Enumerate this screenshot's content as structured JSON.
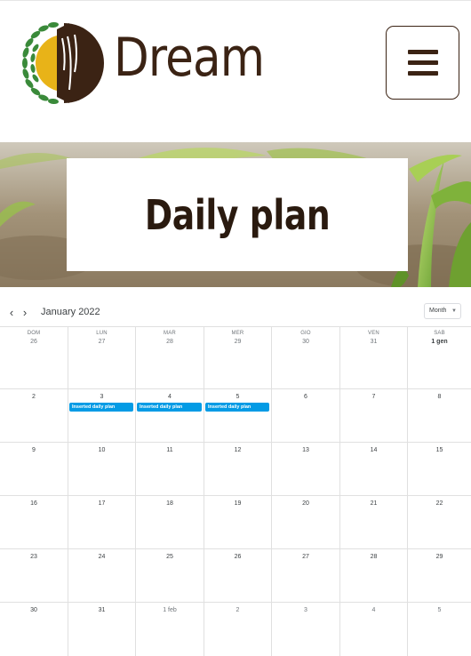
{
  "header": {
    "brand": "Dream",
    "menu_icon": "hamburger-menu-icon",
    "logo_colors": {
      "brown": "#3b2314",
      "yellow": "#e8b318",
      "green": "#3a8a3a"
    }
  },
  "hero": {
    "title": "Daily plan"
  },
  "calendar": {
    "month_label": "January 2022",
    "view_label": "Month",
    "prev_icon": "chevron-left-icon",
    "next_icon": "chevron-right-icon",
    "weekdays": [
      "DOM",
      "LUN",
      "MAR",
      "MER",
      "GIO",
      "VEN",
      "SAB"
    ],
    "weeks": [
      [
        {
          "d": "26",
          "other": true
        },
        {
          "d": "27",
          "other": true
        },
        {
          "d": "28",
          "other": true
        },
        {
          "d": "29",
          "other": true
        },
        {
          "d": "30",
          "other": true
        },
        {
          "d": "31",
          "other": true
        },
        {
          "d": "1 gen",
          "bold": true
        }
      ],
      [
        {
          "d": "2"
        },
        {
          "d": "3",
          "event": "Inserted daily plan"
        },
        {
          "d": "4",
          "event": "Inserted daily plan"
        },
        {
          "d": "5",
          "event": "Inserted daily plan"
        },
        {
          "d": "6"
        },
        {
          "d": "7"
        },
        {
          "d": "8"
        }
      ],
      [
        {
          "d": "9"
        },
        {
          "d": "10"
        },
        {
          "d": "11"
        },
        {
          "d": "12"
        },
        {
          "d": "13"
        },
        {
          "d": "14"
        },
        {
          "d": "15"
        }
      ],
      [
        {
          "d": "16"
        },
        {
          "d": "17"
        },
        {
          "d": "18"
        },
        {
          "d": "19"
        },
        {
          "d": "20"
        },
        {
          "d": "21"
        },
        {
          "d": "22"
        }
      ],
      [
        {
          "d": "23"
        },
        {
          "d": "24"
        },
        {
          "d": "25"
        },
        {
          "d": "26"
        },
        {
          "d": "27"
        },
        {
          "d": "28"
        },
        {
          "d": "29"
        }
      ],
      [
        {
          "d": "30"
        },
        {
          "d": "31"
        },
        {
          "d": "1 feb",
          "other": true
        },
        {
          "d": "2",
          "other": true
        },
        {
          "d": "3",
          "other": true
        },
        {
          "d": "4",
          "other": true
        },
        {
          "d": "5",
          "other": true
        }
      ]
    ],
    "event_color": "#039be5"
  }
}
